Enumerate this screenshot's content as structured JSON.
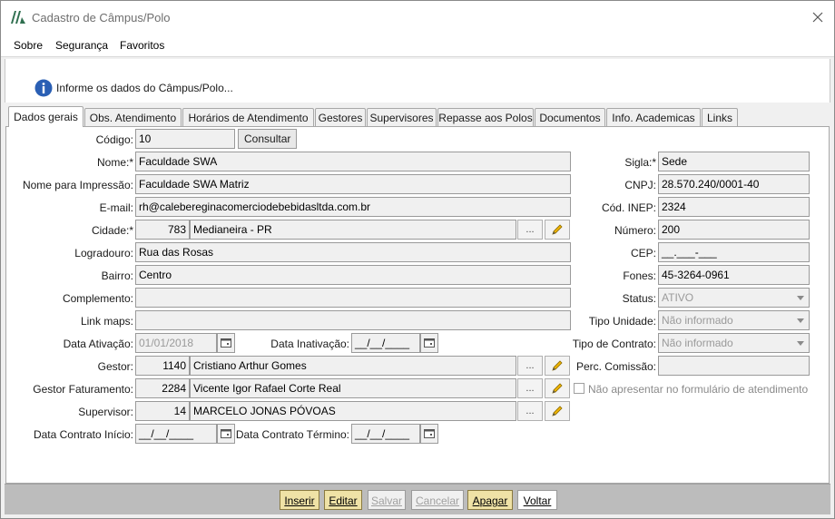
{
  "window": {
    "title": "Cadastro de Câmpus/Polo"
  },
  "menu": {
    "items": [
      "Sobre",
      "Segurança",
      "Favoritos"
    ]
  },
  "header": {
    "info": "Informe os dados do Câmpus/Polo..."
  },
  "tabs": [
    "Dados gerais",
    "Obs. Atendimento",
    "Horários de Atendimento",
    "Gestores",
    "Supervisores",
    "Repasse aos Polos",
    "Documentos",
    "Info. Academicas",
    "Links"
  ],
  "form": {
    "codigo": {
      "label": "Código:",
      "value": "10",
      "button": "Consultar"
    },
    "nome": {
      "label": "Nome:*",
      "value": "Faculdade SWA"
    },
    "nome_impressao": {
      "label": "Nome para Impressão:",
      "value": "Faculdade SWA Matriz"
    },
    "email": {
      "label": "E-mail:",
      "value": "rh@calebereginacomerciodebebidasltda.com.br"
    },
    "cidade": {
      "label": "Cidade:*",
      "code": "783",
      "value": "Medianeira - PR"
    },
    "logradouro": {
      "label": "Logradouro:",
      "value": "Rua das Rosas"
    },
    "bairro": {
      "label": "Bairro:",
      "value": "Centro"
    },
    "complemento": {
      "label": "Complemento:",
      "value": ""
    },
    "link_maps": {
      "label": "Link maps:",
      "value": ""
    },
    "data_ativacao": {
      "label": "Data Ativação:",
      "value": "01/01/2018"
    },
    "data_inativacao": {
      "label": "Data Inativação:",
      "value": "__/__/____"
    },
    "gestor": {
      "label": "Gestor:",
      "code": "1140",
      "value": "Cristiano Arthur Gomes"
    },
    "gestor_faturamento": {
      "label": "Gestor Faturamento:",
      "code": "2284",
      "value": "Vicente Igor Rafael Corte Real"
    },
    "supervisor": {
      "label": "Supervisor:",
      "code": "14",
      "value": "MARCELO JONAS PÓVOAS"
    },
    "data_contrato_inicio": {
      "label": "Data Contrato Início:",
      "value": "__/__/____"
    },
    "data_contrato_termino": {
      "label": "Data Contrato Término:",
      "value": "__/__/____"
    },
    "sigla": {
      "label": "Sigla:*",
      "value": "Sede"
    },
    "cnpj": {
      "label": "CNPJ:",
      "value": "28.570.240/0001-40"
    },
    "cod_inep": {
      "label": "Cód. INEP:",
      "value": "2324"
    },
    "numero": {
      "label": "Número:",
      "value": "200"
    },
    "cep": {
      "label": "CEP:",
      "value": "__.___-___"
    },
    "fones": {
      "label": "Fones:",
      "value": "45-3264-0961"
    },
    "status": {
      "label": "Status:",
      "value": "ATIVO"
    },
    "tipo_unidade": {
      "label": "Tipo Unidade:",
      "value": "Não informado"
    },
    "tipo_contrato": {
      "label": "Tipo de Contrato:",
      "value": "Não informado"
    },
    "perc_comissao": {
      "label": "Perc. Comissão:",
      "value": ""
    },
    "nao_apresentar": {
      "label": "Não apresentar no formulário de atendimento",
      "checked": false
    },
    "dots": "..."
  },
  "buttons": {
    "inserir": "Inserir",
    "editar": "Editar",
    "salvar": "Salvar",
    "cancelar": "Cancelar",
    "apagar": "Apagar",
    "voltar": "Voltar"
  },
  "colors": {
    "accent_yellow": "#efe2a6",
    "bottom_bar": "#bcbcbc",
    "field_bg": "#f0f0f0"
  }
}
